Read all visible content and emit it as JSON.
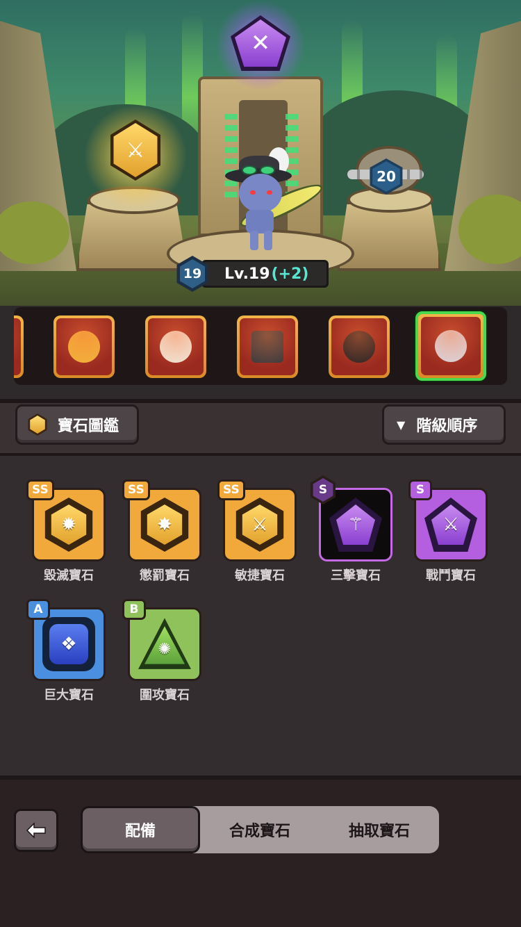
{
  "scene": {
    "level_badge": "19",
    "level_label": "Lv.19",
    "level_bonus": "(+2)",
    "locked_slot_level": "20",
    "top_gem_icon": "purple-x-gem-icon",
    "left_gem_icon": "gold-sword-gem-icon"
  },
  "heroes": [
    {
      "name": "hero-partial"
    },
    {
      "name": "hero-tophat-pumpkin"
    },
    {
      "name": "hero-white-yeti"
    },
    {
      "name": "hero-robot-box"
    },
    {
      "name": "hero-plague-doctor"
    },
    {
      "name": "hero-hooded-ghost",
      "selected": true
    }
  ],
  "header": {
    "codex_label": "寶石圖鑑",
    "sort_label": "階級順序"
  },
  "gems": [
    {
      "rank": "SS",
      "label": "毀滅寶石",
      "color": "#f0a93a",
      "icon": "burst-icon"
    },
    {
      "rank": "SS",
      "label": "懲罰寶石",
      "color": "#f0a93a",
      "icon": "punish-icon"
    },
    {
      "rank": "SS",
      "label": "敏捷寶石",
      "color": "#f0a93a",
      "icon": "agile-sword-icon"
    },
    {
      "rank": "S",
      "label": "三擊寶石",
      "color": "#b45ee0",
      "icon": "triple-strike-icon"
    },
    {
      "rank": "S",
      "label": "戰鬥寶石",
      "color": "#b45ee0",
      "icon": "battle-sword-icon"
    },
    {
      "rank": "A",
      "label": "巨大寶石",
      "color": "#4a8fe0",
      "icon": "giant-icon"
    },
    {
      "rank": "B",
      "label": "圍攻寶石",
      "color": "#8fc25a",
      "icon": "siege-icon"
    }
  ],
  "bottom": {
    "tabs": [
      "配備",
      "合成寶石",
      "抽取寶石"
    ],
    "active_tab": "配備"
  }
}
